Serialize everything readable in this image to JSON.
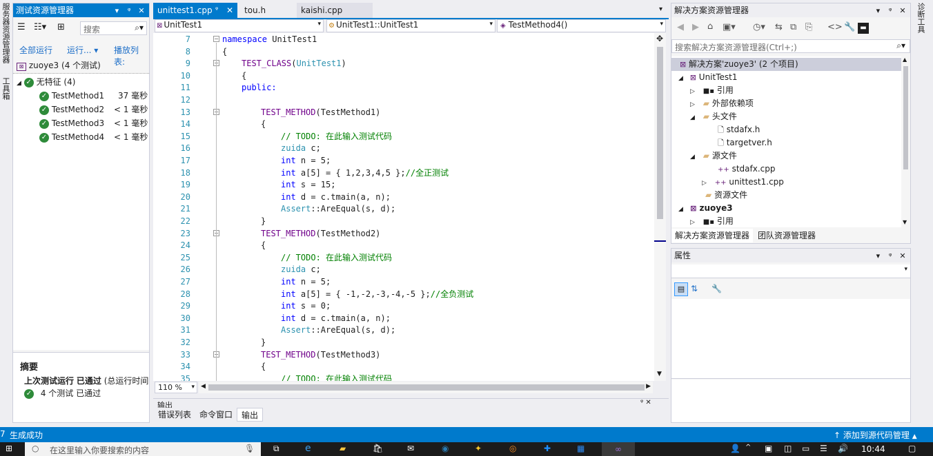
{
  "left_vtabs": [
    "服务器资源管理器",
    "工具箱"
  ],
  "right_vtabs": [
    "诊断工具"
  ],
  "test_explorer": {
    "title": "测试资源管理器",
    "search_placeholder": "搜索",
    "run_all": "全部运行",
    "run": "运行...",
    "playlist": "播放列表:",
    "project": "zuoye3 (4 个测试)",
    "group": "无特征 (4)",
    "tests": [
      {
        "name": "TestMethod1",
        "time": "37 毫秒"
      },
      {
        "name": "TestMethod2",
        "time": "< 1 毫秒"
      },
      {
        "name": "TestMethod3",
        "time": "< 1 毫秒"
      },
      {
        "name": "TestMethod4",
        "time": "< 1 毫秒"
      }
    ],
    "summary_title": "摘要",
    "last_run_prefix": "上次测试运行",
    "last_run_status": "已通过",
    "last_run_suffix": "(总运行时间",
    "passed_text": "4 个测试 已通过"
  },
  "editor": {
    "tabs": [
      "unittest1.cpp",
      "tou.h",
      "kaishi.cpp"
    ],
    "nav_project": "UnitTest1",
    "nav_class": "UnitTest1::UnitTest1",
    "nav_method": "TestMethod4()",
    "zoom": "110 %",
    "line_numbers": [
      "7",
      "8",
      "9",
      "10",
      "11",
      "12",
      "13",
      "14",
      "15",
      "16",
      "17",
      "18",
      "19",
      "20",
      "21",
      "22",
      "23",
      "24",
      "25",
      "26",
      "27",
      "28",
      "29",
      "30",
      "31",
      "32",
      "33",
      "34",
      "35"
    ],
    "code": {
      "l7_kw": "namespace",
      "l7_rest": " UnitTest1",
      "l8": "{",
      "l9_mac": "TEST_CLASS",
      "l9_p1": "(",
      "l9_ty": "UnitTest1",
      "l9_p2": ")",
      "l10": "{",
      "l11": "public:",
      "l13_mac": "TEST_METHOD",
      "l13_rest": "(TestMethod1)",
      "l14": "{",
      "l15": "// TODO: 在此输入测试代码",
      "l16_ty": "zuida",
      "l16_rest": " c;",
      "l17_kw": "int",
      "l17_rest": " n = 5;",
      "l18_kw": "int",
      "l18_rest": " a[5] = { 1,2,3,4,5 };",
      "l18_cm": "//全正测试",
      "l19_kw": "int",
      "l19_rest": " s = 15;",
      "l20_kw": "int",
      "l20_rest": " d = c.tmain(a, n);",
      "l21_ty": "Assert",
      "l21_rest": "::AreEqual(s, d);",
      "l22": "}",
      "l23_mac": "TEST_METHOD",
      "l23_rest": "(TestMethod2)",
      "l24": "{",
      "l25": "// TODO: 在此输入测试代码",
      "l26_ty": "zuida",
      "l26_rest": " c;",
      "l27_kw": "int",
      "l27_rest": " n = 5;",
      "l28_kw": "int",
      "l28_rest": " a[5] = { -1,-2,-3,-4,-5 };",
      "l28_cm": "//全负测试",
      "l29_kw": "int",
      "l29_rest": " s = 0;",
      "l30_kw": "int",
      "l30_rest": " d = c.tmain(a, n);",
      "l31_ty": "Assert",
      "l31_rest": "::AreEqual(s, d);",
      "l32": "}",
      "l33_mac": "TEST_METHOD",
      "l33_rest": "(TestMethod3)",
      "l34": "{",
      "l35": "// TODO: 在此输入测试代码"
    }
  },
  "output_panel": {
    "title": "输出",
    "tabs": [
      "错误列表",
      "命令窗口",
      "输出"
    ]
  },
  "solution_explorer": {
    "title": "解决方案资源管理器",
    "search_placeholder": "搜索解决方案资源管理器(Ctrl+;)",
    "solution": "解决方案'zuoye3' (2 个项目)",
    "items": [
      "UnitTest1",
      "引用",
      "外部依赖项",
      "头文件",
      "stdafx.h",
      "targetver.h",
      "源文件",
      "stdafx.cpp",
      "unittest1.cpp",
      "资源文件",
      "zuoye3",
      "引用"
    ],
    "bottom_tabs": [
      "解决方案资源管理器",
      "团队资源管理器"
    ]
  },
  "properties": {
    "title": "属性"
  },
  "status_bar": {
    "text": "生成成功",
    "source_control": "添加到源代码管理",
    "background": "#007ACC"
  },
  "taskbar": {
    "search_placeholder": "在这里输入你要搜索的内容",
    "time": "10:44"
  }
}
